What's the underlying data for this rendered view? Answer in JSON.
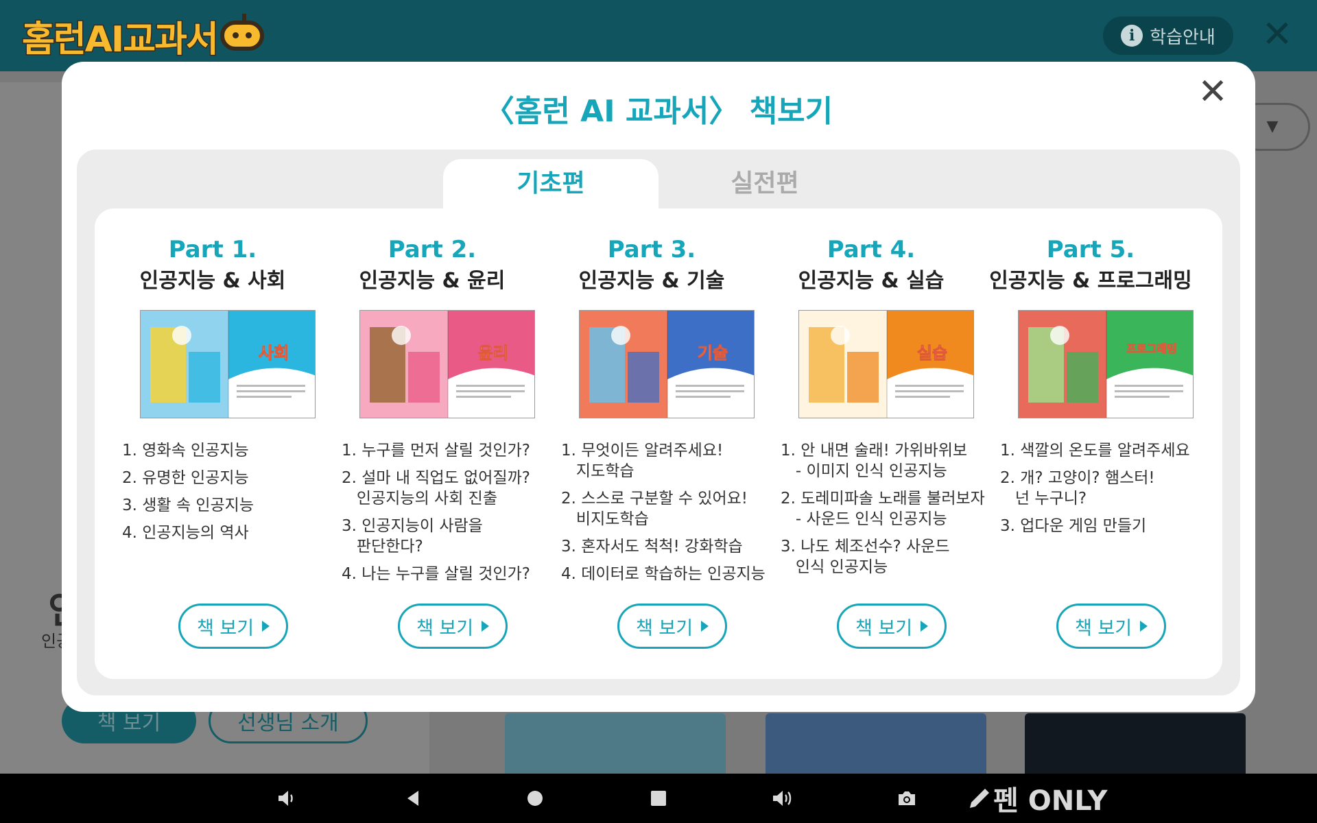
{
  "app": {
    "logo_text": "홈런AI교과서",
    "guide_label": "학습안내",
    "close_symbol": "✕"
  },
  "background": {
    "book_button": "책 보기",
    "teacher_button": "선생님 소개",
    "partial_heading": "인",
    "partial_text": "인공",
    "dropdown_symbol": "▼"
  },
  "modal": {
    "title": "〈홈런 AI 교과서〉 책보기",
    "close_symbol": "✕",
    "tabs": [
      {
        "label": "기초편",
        "active": true
      },
      {
        "label": "실전편",
        "active": false
      }
    ],
    "parts": [
      {
        "number": "Part 1.",
        "title": "인공지능 & 사회",
        "cover_label": "사회",
        "cover_colors": [
          "#2bb6e0",
          "#8fd3ef",
          "#f4d23a"
        ],
        "items": [
          "1. 영화속 인공지능",
          "2. 유명한 인공지능",
          "3. 생활 속 인공지능",
          "4. 인공지능의 역사"
        ],
        "button": "책 보기"
      },
      {
        "number": "Part 2.",
        "title": "인공지능 & 윤리",
        "cover_label": "윤리",
        "cover_colors": [
          "#e95a86",
          "#f7a9c0",
          "#9b6a3a"
        ],
        "items": [
          "1. 누구를 먼저 살릴 것인가?",
          "2. 설마 내 직업도 없어질까?\n   인공지능의 사회 진출",
          "3. 인공지능이 사람을\n   판단한다?",
          "4. 나는 누구를 살릴 것인가?"
        ],
        "button": "책 보기"
      },
      {
        "number": "Part 3.",
        "title": "인공지능 & 기술",
        "cover_label": "기술",
        "cover_colors": [
          "#3d6fc7",
          "#f07a5a",
          "#6ac0e8"
        ],
        "items": [
          "1. 무엇이든 알려주세요!\n   지도학습",
          "2. 스스로 구분할 수 있어요!\n   비지도학습",
          "3. 혼자서도 척척! 강화학습",
          "4. 데이터로 학습하는 인공지능"
        ],
        "button": "책 보기"
      },
      {
        "number": "Part 4.",
        "title": "인공지능 & 실습",
        "cover_label": "실습",
        "cover_colors": [
          "#f08a1e",
          "#fff4e0",
          "#f6b64a"
        ],
        "items": [
          "1. 안 내면 술래! 가위바위보\n   - 이미지 인식 인공지능",
          "2. 도레미파솔 노래를 불러보자\n   - 사운드 인식 인공지능",
          "3. 나도 체조선수? 사운드\n   인식 인공지능"
        ],
        "button": "책 보기"
      },
      {
        "number": "Part 5.",
        "title": "인공지능 & 프로그래밍",
        "cover_label": "프로그래밍",
        "cover_colors": [
          "#3bb55a",
          "#e86a5a",
          "#9edc8a"
        ],
        "items": [
          "1. 색깔의 온도를 알려주세요",
          "2. 개? 고양이? 햄스터!\n   넌 누구니?",
          "3. 업다운 게임 만들기"
        ],
        "button": "책 보기"
      }
    ]
  },
  "navbar": {
    "icons": [
      "volume-down-icon",
      "back-icon",
      "home-icon",
      "recents-icon",
      "volume-up-icon",
      "camera-icon"
    ],
    "pen_label": "펜 ONLY"
  }
}
